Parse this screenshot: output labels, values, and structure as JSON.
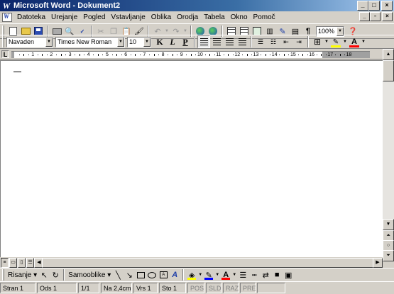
{
  "window": {
    "title": "Microsoft Word - Dokument2",
    "app_icon": "word-icon",
    "buttons": [
      "minimize",
      "maximize",
      "close"
    ]
  },
  "menu": {
    "items": [
      "Datoteka",
      "Urejanje",
      "Pogled",
      "Vstavljanje",
      "Oblika",
      "Orodja",
      "Tabela",
      "Okno",
      "Pomoč"
    ]
  },
  "standard_toolbar": {
    "zoom": "100%"
  },
  "formatting_toolbar": {
    "style": "Navaden",
    "font": "Times New Roman",
    "size": "10"
  },
  "ruler": {
    "tab_symbol": "L",
    "labels": [
      "1",
      "2",
      "3",
      "4",
      "5",
      "6",
      "7",
      "8",
      "9",
      "10",
      "11",
      "12",
      "13",
      "14",
      "15",
      "16",
      "17",
      "18"
    ]
  },
  "drawing_toolbar": {
    "draw_label": "Risanje",
    "autoshapes_label": "Samooblike"
  },
  "status_bar": {
    "page": "Stran  1",
    "section": "Ods  1",
    "pages": "1/1",
    "position": "Na 2,4cm",
    "line": "Vrs  1",
    "column": "Sto  1",
    "rec": "POS",
    "trk": "SLD",
    "ext": "RAZ",
    "ovr": "PRE"
  },
  "colors": {
    "title_bar": "#0a246a",
    "highlight": "#ffff00",
    "font_color": "#ff0000",
    "line_color": "#0000ff"
  }
}
